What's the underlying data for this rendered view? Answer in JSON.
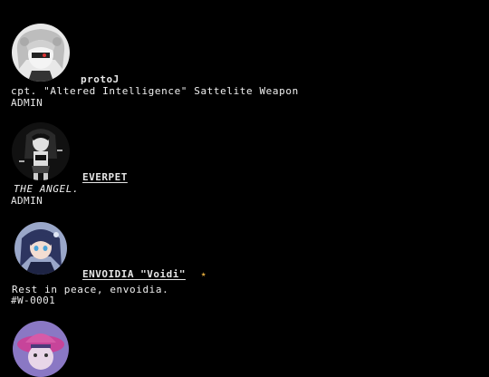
{
  "profiles": [
    {
      "avatar_icon": "avatar-white-haired-character",
      "name": "protoJ",
      "bio": "cpt. \"Altered Intelligence\" Sattelite Weapon",
      "role": "ADMIN"
    },
    {
      "avatar_icon": "avatar-dark-haired-figure",
      "name": "EVERPET",
      "bio": "THE ANGEL.",
      "role": "ADMIN"
    },
    {
      "avatar_icon": "avatar-blue-haired-character",
      "name": "ENVOIDIA \"Voidi\"",
      "badge_icon": "star-icon",
      "badge_color": "#d8a23a",
      "bio": "Rest in peace, envoidia.",
      "role": "#W-0001"
    },
    {
      "avatar_icon": "avatar-purple-hat-character"
    }
  ]
}
